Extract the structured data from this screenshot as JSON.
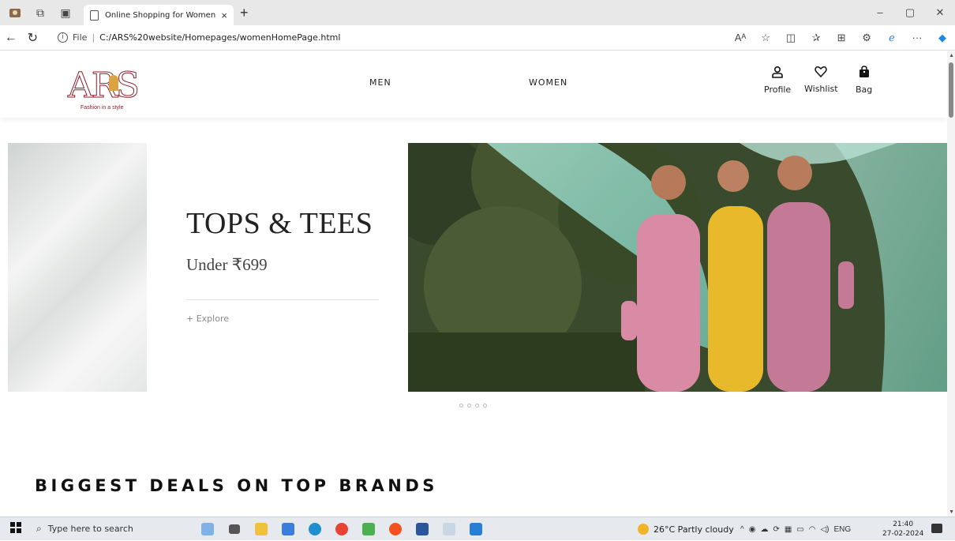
{
  "browser": {
    "tab_title": "Online Shopping for Women",
    "tab_close": "×",
    "new_tab": "+",
    "url_prefix": "File",
    "url_separator": "|",
    "url": "C:/ARS%20website/Homepages/womenHomePage.html",
    "window_controls": [
      "–",
      "▢",
      "✕"
    ]
  },
  "site": {
    "logo": {
      "text": "ARS",
      "tagline": "Fashion in a style"
    },
    "menu": [
      "MEN",
      "WOMEN"
    ],
    "actions": [
      {
        "label": "Profile",
        "icon": "user-icon"
      },
      {
        "label": "Wishlist",
        "icon": "heart-icon"
      },
      {
        "label": "Bag",
        "icon": "bag-icon"
      }
    ],
    "hero": {
      "title": "TOPS & TEES",
      "subtitle": "Under ₹699",
      "cta": "+ Explore",
      "slide_count": 4,
      "active_slide": 1
    },
    "section_title": "BIGGEST DEALS ON TOP BRANDS"
  },
  "taskbar": {
    "search_placeholder": "Type here to search",
    "weather": "26°C  Partly cloudy",
    "language": "ENG",
    "time": "21:40",
    "date": "27-02-2024"
  },
  "colors": {
    "brand": "#8b1e2d",
    "accent": "#d9a441"
  }
}
